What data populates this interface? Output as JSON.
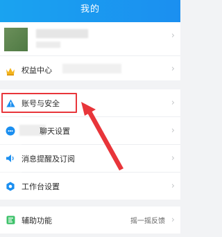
{
  "header": {
    "title": "我的"
  },
  "profile": {},
  "menu": {
    "benefits": {
      "label": "权益中心"
    },
    "account_security": {
      "label": "账号与安全"
    },
    "chat_settings": {
      "label": "聊天设置"
    },
    "notifications": {
      "label": "消息提醒及订阅"
    },
    "workbench": {
      "label": "工作台设置"
    },
    "accessibility": {
      "label": "辅助功能",
      "value": "摇一摇反馈"
    }
  },
  "icons": {
    "crown": "crown-icon",
    "warning": "warning-triangle-icon",
    "chat": "chat-bubble-icon",
    "speaker": "speaker-icon",
    "gear": "gear-icon",
    "accessibility": "accessibility-icon",
    "chevron": "chevron-right-icon"
  },
  "colors": {
    "header_bg": "#1b96f0",
    "highlight": "#e8353a",
    "accent_blue": "#1b8ff0"
  }
}
